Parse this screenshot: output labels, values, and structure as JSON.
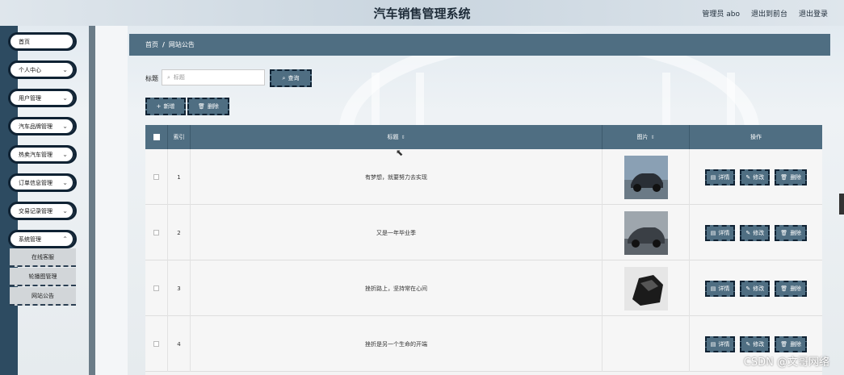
{
  "header": {
    "title": "汽车销售管理系统",
    "admin": "管理员 abo",
    "front": "退出到前台",
    "logout": "退出登录"
  },
  "sidebar": {
    "items": [
      {
        "label": "首页"
      },
      {
        "label": "个人中心"
      },
      {
        "label": "用户管理"
      },
      {
        "label": "汽车品牌管理"
      },
      {
        "label": "热卖汽车管理"
      },
      {
        "label": "订单信息管理"
      },
      {
        "label": "交易记录管理"
      },
      {
        "label": "系统管理"
      }
    ],
    "submenu": [
      {
        "label": "在线客服"
      },
      {
        "label": "轮播图管理"
      },
      {
        "label": "网站公告"
      }
    ]
  },
  "breadcrumb": {
    "home": "首页",
    "sep": "/",
    "current": "网站公告"
  },
  "search": {
    "label": "标题",
    "placeholder": "标题",
    "button": "查询"
  },
  "actions": {
    "add": "新增",
    "delete": "删除"
  },
  "table": {
    "headers": {
      "index": "索引",
      "title": "标题",
      "image": "图片",
      "ops": "操作"
    },
    "rows": [
      {
        "index": "1",
        "title": "有梦想，就要努力去实现"
      },
      {
        "index": "2",
        "title": "又是一年毕业季"
      },
      {
        "index": "3",
        "title": "挫折路上，坚持常在心间"
      },
      {
        "index": "4",
        "title": "挫折是另一个生命的开端"
      }
    ],
    "op_labels": {
      "detail": "详情",
      "edit": "修改",
      "delete": "删除"
    }
  },
  "watermark": "CSDN @文哥网络",
  "colors": {
    "primary": "#4f6e82",
    "sidebar_dark": "#2d4b61",
    "border_dark": "#0f2233"
  }
}
